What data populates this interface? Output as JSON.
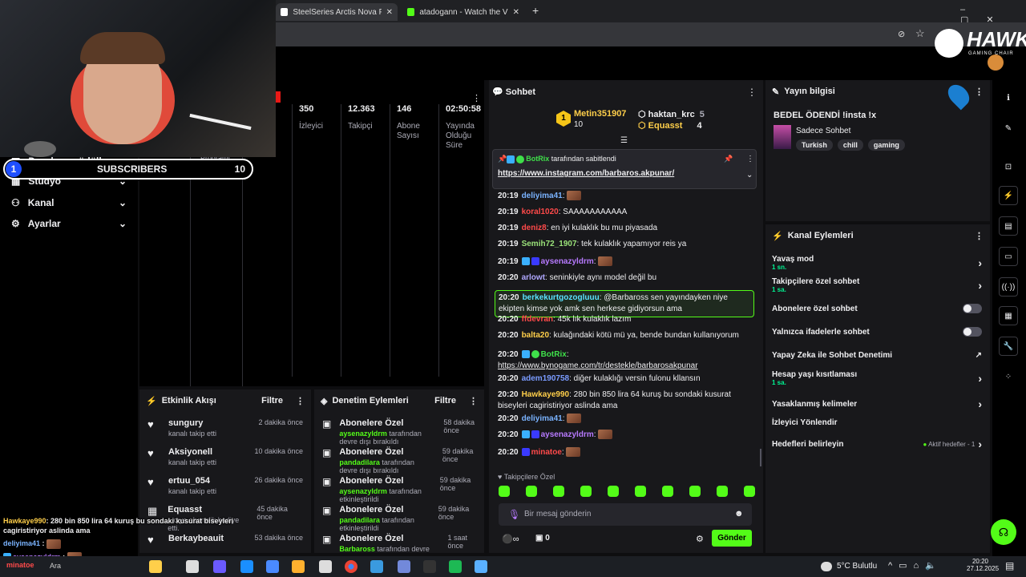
{
  "browser": {
    "tabs": [
      {
        "label": "SteelSeries Arctis Nova Pro X W"
      },
      {
        "label": "atadogann - Watch the VOD on"
      }
    ]
  },
  "logo": {
    "brand": "HAWK",
    "tagline": "GAMING CHAIR"
  },
  "overlay": {
    "sub_count_left": "1",
    "sub_label": "SUBSCRIBERS",
    "sub_count_right": "10"
  },
  "nav": {
    "items": [
      {
        "label": "Droplar ve ödüller"
      },
      {
        "label": "Stüdyo"
      },
      {
        "label": "Kanal"
      },
      {
        "label": "Ayarlar"
      }
    ],
    "behind_label": "Programı"
  },
  "stats": [
    {
      "value": "350",
      "label": "İzleyici"
    },
    {
      "value": "12.363",
      "label": "Takipçi"
    },
    {
      "value": "146",
      "label": "Abone Sayısı"
    },
    {
      "value": "02:50:58",
      "label": "Yayında Olduğu Süre"
    }
  ],
  "activity": {
    "title": "Etkinlik Akışı",
    "filter": "Filtre",
    "items": [
      {
        "name": "sungury",
        "action": "kanalı takip etti",
        "time": "2 dakika önce"
      },
      {
        "name": "Aksiyonell",
        "action": "kanalı takip etti",
        "time": "10 dakika önce"
      },
      {
        "name": "ertuu_054",
        "action": "kanalı takip etti",
        "time": "26 dakika önce"
      },
      {
        "name": "Equasst",
        "action": "...cıya abonelik hediye etti.",
        "time": "45 dakika önce"
      },
      {
        "name": "Berkaybeauit",
        "action": "",
        "time": "53 dakika önce"
      }
    ]
  },
  "moderation": {
    "title": "Denetim Eylemleri",
    "filter": "Filtre",
    "items": [
      {
        "title": "Abonelere Özel",
        "user": "aysenazyldrm",
        "rest": " tarafından devre dışı bırakıldı",
        "time": "58 dakika önce"
      },
      {
        "title": "Abonelere Özel",
        "user": "pandadilara",
        "rest": " tarafından devre dışı bırakıldı",
        "time": "59 dakika önce"
      },
      {
        "title": "Abonelere Özel",
        "user": "aysenazyldrm",
        "rest": " tarafından etkinleştirildi",
        "time": "59 dakika önce"
      },
      {
        "title": "Abonelere Özel",
        "user": "pandadilara",
        "rest": " tarafından etkinleştirildi",
        "time": "59 dakika önce"
      },
      {
        "title": "Abonelere Özel",
        "user": "Barbaross",
        "rest": " tarafından devre dışı bırakıldı",
        "time": "1 saat önce"
      }
    ]
  },
  "chat": {
    "title": "Sohbet",
    "leaders": [
      {
        "rank": "1",
        "name": "Metin351907",
        "count": "10"
      },
      {
        "name": "haktan_krc",
        "count": "5"
      },
      {
        "name": "Equasst",
        "count": "4"
      }
    ],
    "pinned": {
      "by": "BotRix",
      "by_suffix": "tarafından sabitlendi",
      "link": "https://www.instagram.com/barbaros.akpunar/"
    },
    "messages": [
      {
        "time": "20:19",
        "user": "deliyima41",
        "color": "#7ab3ff",
        "text": ""
      },
      {
        "time": "20:19",
        "user": "koral1020",
        "color": "#ff4a4a",
        "text": "SAAAAAAAAAAA"
      },
      {
        "time": "20:19",
        "user": "deniz8",
        "color": "#ff4a4a",
        "text": "en iyi kulaklık bu mu piyasada"
      },
      {
        "time": "20:19",
        "user": "Semih72_1907",
        "color": "#9be37a",
        "text": "tek kulaklık yapamıyor reis ya"
      },
      {
        "time": "20:19",
        "user": "aysenazyldrm",
        "color": "#b77aff",
        "text": ""
      },
      {
        "time": "20:20",
        "user": "arlowt",
        "color": "#b0a8ff",
        "text": "seninkiyle aynı model değil bu"
      },
      {
        "time": "20:20",
        "user": "berkekurtgozogluuu",
        "color": "#5ae3ff",
        "text": "@Barbaross sen yayındayken niye ekipten kimse yok amk sen herkese gidiyorsun ama"
      },
      {
        "time": "20:20",
        "user": "ffdevran",
        "color": "#ff4a4a",
        "text": "45k lık kulaklık lazım"
      },
      {
        "time": "20:20",
        "user": "balta20",
        "color": "#ffcf4a",
        "text": "kulağındaki kötü mü ya, bende bundan kullanıyorum"
      },
      {
        "time": "20:20",
        "user": "BotRix",
        "color": "#3fe04a",
        "text": "https://www.bynogame.com/tr/destekle/barbarosakpunar"
      },
      {
        "time": "20:20",
        "user": "adem190758",
        "color": "#7a9bff",
        "text": "diğer kulaklığı versin fulonu kllansın"
      },
      {
        "time": "20:20",
        "user": "Hawkaye990",
        "color": "#ffcf4a",
        "text": "280 bin 850 lira 64 kuruş bu sondaki kusurat biseyleri cagiristiriyor aslinda ama"
      },
      {
        "time": "20:20",
        "user": "deliyima41",
        "color": "#7ab3ff",
        "text": ""
      },
      {
        "time": "20:20",
        "user": "aysenazyldrm",
        "color": "#b77aff",
        "text": ""
      },
      {
        "time": "20:20",
        "user": "minatoe",
        "color": "#ff4a4a",
        "text": ""
      }
    ],
    "followers_only": "Takipçilere Özel",
    "input_placeholder": "Bir mesaj gönderin",
    "points": "0",
    "send": "Gönder"
  },
  "stream_info": {
    "title": "Yayın bilgisi",
    "stream_title": "BEDEL ÖDENDİ !insta !x",
    "category": "Sadece Sohbet",
    "tags": [
      "Turkish",
      "chill",
      "gaming"
    ]
  },
  "channel_actions": {
    "title": "Kanal Eylemleri",
    "items": [
      {
        "label": "Yavaş mod",
        "sub": "1 sn."
      },
      {
        "label": "Takipçilere özel sohbet",
        "sub": "1 sa."
      },
      {
        "label": "Abonelere özel sohbet",
        "sub": ""
      },
      {
        "label": "Yalnızca ifadelerle sohbet",
        "sub": ""
      },
      {
        "label": "Yapay Zeka ile Sohbet Denetimi",
        "sub": ""
      },
      {
        "label": "Hesap yaşı kısıtlaması",
        "sub": "1 sa."
      },
      {
        "label": "Yasaklanmış kelimeler",
        "sub": ""
      },
      {
        "label": "İzleyici Yönlendir",
        "sub": ""
      },
      {
        "label": "Hedefleri belirleyin",
        "sub": ""
      }
    ],
    "goals_status": "Aktif hedefler - 1"
  },
  "overlay_chat": [
    {
      "user": "Hawkaye990",
      "text": ": 280 bin 850 lira 64 kuruş bu sondaki kusurat biseyleri cagiristiriyor aslinda ama"
    },
    {
      "user": "deliyima41",
      "text": ":"
    },
    {
      "user": "aysenazyldrm",
      "text": ":"
    },
    {
      "user": "minatoe",
      "text": ":"
    }
  ],
  "taskbar": {
    "search": "Ara",
    "weather": "5°C  Bulutlu",
    "time": "20:20",
    "date": "27.12.2025"
  }
}
